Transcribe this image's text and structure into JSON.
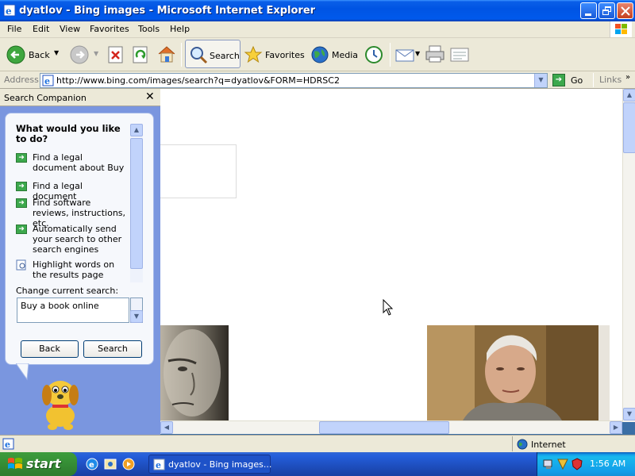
{
  "window": {
    "title": "dyatlov - Bing images - Microsoft Internet Explorer"
  },
  "menu": [
    "File",
    "Edit",
    "View",
    "Favorites",
    "Tools",
    "Help"
  ],
  "toolbar": {
    "back_label": "Back",
    "search_label": "Search",
    "favorites_label": "Favorites",
    "media_label": "Media"
  },
  "address": {
    "label": "Address",
    "url": "http://www.bing.com/images/search?q=dyatlov&FORM=HDRSC2",
    "go_label": "Go",
    "links_label": "Links"
  },
  "search_companion": {
    "header": "Search Companion",
    "question": "What would you like to do?",
    "options": [
      "Find a legal document about Buy",
      "Find a legal document",
      "Find software reviews, instructions, etc.",
      "Automatically send your search to other search engines",
      "Highlight words on the results page"
    ],
    "change_label": "Change current search:",
    "current_search": "Buy a book online",
    "back_button": "Back",
    "search_button": "Search"
  },
  "status": {
    "zone": "Internet"
  },
  "taskbar": {
    "start_label": "start",
    "task_label": "dyatlov - Bing images...",
    "clock": "1:56 AM"
  }
}
